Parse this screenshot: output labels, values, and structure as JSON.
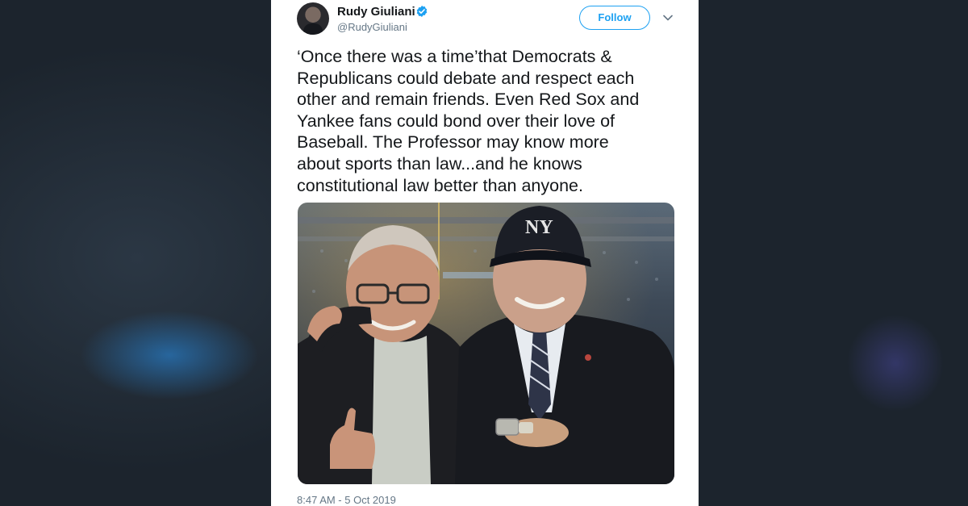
{
  "tweet": {
    "author_name": "Rudy Giuliani",
    "author_handle": "@RudyGiuliani",
    "follow_label": "Follow",
    "text_lines": [
      "‘Once there was a time’that Democrats &",
      "Republicans could debate and respect each",
      "other and remain friends. Even Red Sox and",
      "Yankee fans could bond over their love of",
      "Baseball. The Professor may know more",
      "about sports than law...and he knows",
      "constitutional law better than anyone."
    ],
    "timestamp": "8:47 AM - 5 Oct 2019",
    "photo_cap_logo": "NY"
  },
  "icons": {
    "verified": "verified-badge-icon",
    "menu": "chevron-down-icon"
  },
  "colors": {
    "accent": "#1da1f2",
    "text_primary": "#14171a",
    "text_secondary": "#657786",
    "background_blur": "#1f2730"
  }
}
